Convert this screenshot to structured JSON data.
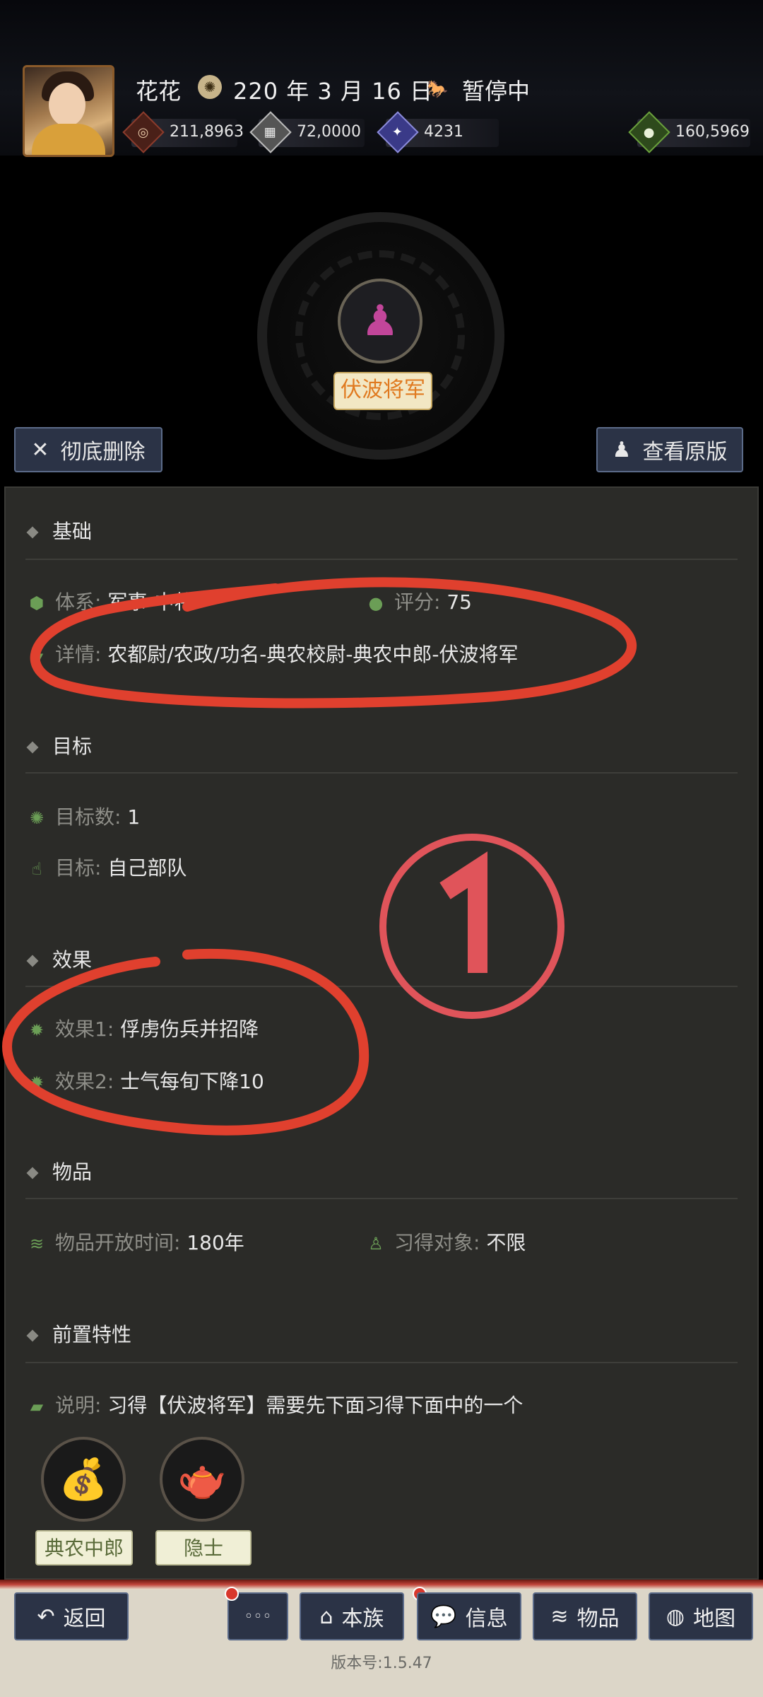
{
  "header": {
    "player_name": "花花",
    "date_text": "220 年 3 月 16 日",
    "status": "暂停中",
    "resources": [
      {
        "icon": "coin-stack-icon",
        "value": "211,8963",
        "color": "#8a3b2c"
      },
      {
        "icon": "stone-icon",
        "value": "72,0000",
        "color": "#9c9c9c"
      },
      {
        "icon": "strength-icon",
        "value": "4231",
        "color": "#5a5ab0"
      },
      {
        "icon": "money-bag-icon",
        "value": "160,5969",
        "color": "#6aa03c"
      }
    ]
  },
  "title_tag": "伏波将军",
  "buttons": {
    "delete": "彻底删除",
    "view_original": "查看原版"
  },
  "sections": {
    "basic": {
      "heading": "基础",
      "system_label": "体系:",
      "system_value": "军事-中将",
      "rating_label": "评分:",
      "rating_value": "75",
      "detail_label": "详情:",
      "detail_value": "农都尉/农政/功名-典农校尉-典农中郎-伏波将军"
    },
    "target": {
      "heading": "目标",
      "count_label": "目标数:",
      "count_value": "1",
      "target_label": "目标:",
      "target_value": "自己部队"
    },
    "effect": {
      "heading": "效果",
      "items": [
        {
          "label": "效果1:",
          "value": "俘虏伤兵并招降"
        },
        {
          "label": "效果2:",
          "value": "士气每旬下降10"
        }
      ]
    },
    "item": {
      "heading": "物品",
      "open_time_label": "物品开放时间:",
      "open_time_value": "180年",
      "learner_label": "习得对象:",
      "learner_value": "不限"
    },
    "prereq": {
      "heading": "前置特性",
      "note_label": "说明:",
      "note_value": "习得【伏波将军】需要先下面习得下面中的一个",
      "skills": [
        {
          "label": "典农中郎",
          "icon": "coins-bag-icon"
        },
        {
          "label": "隐士",
          "icon": "teapot-icon"
        }
      ]
    }
  },
  "annotation_mark": "①",
  "nav": {
    "back": "返回",
    "more": "◦◦◦",
    "clan": "本族",
    "info": "信息",
    "items": "物品",
    "map": "地图"
  },
  "version": "版本号:1.5.47",
  "colors": {
    "annotation_red": "#e0402e",
    "panel_bg": "#2b2b28",
    "button_bg": "#2b3346"
  }
}
